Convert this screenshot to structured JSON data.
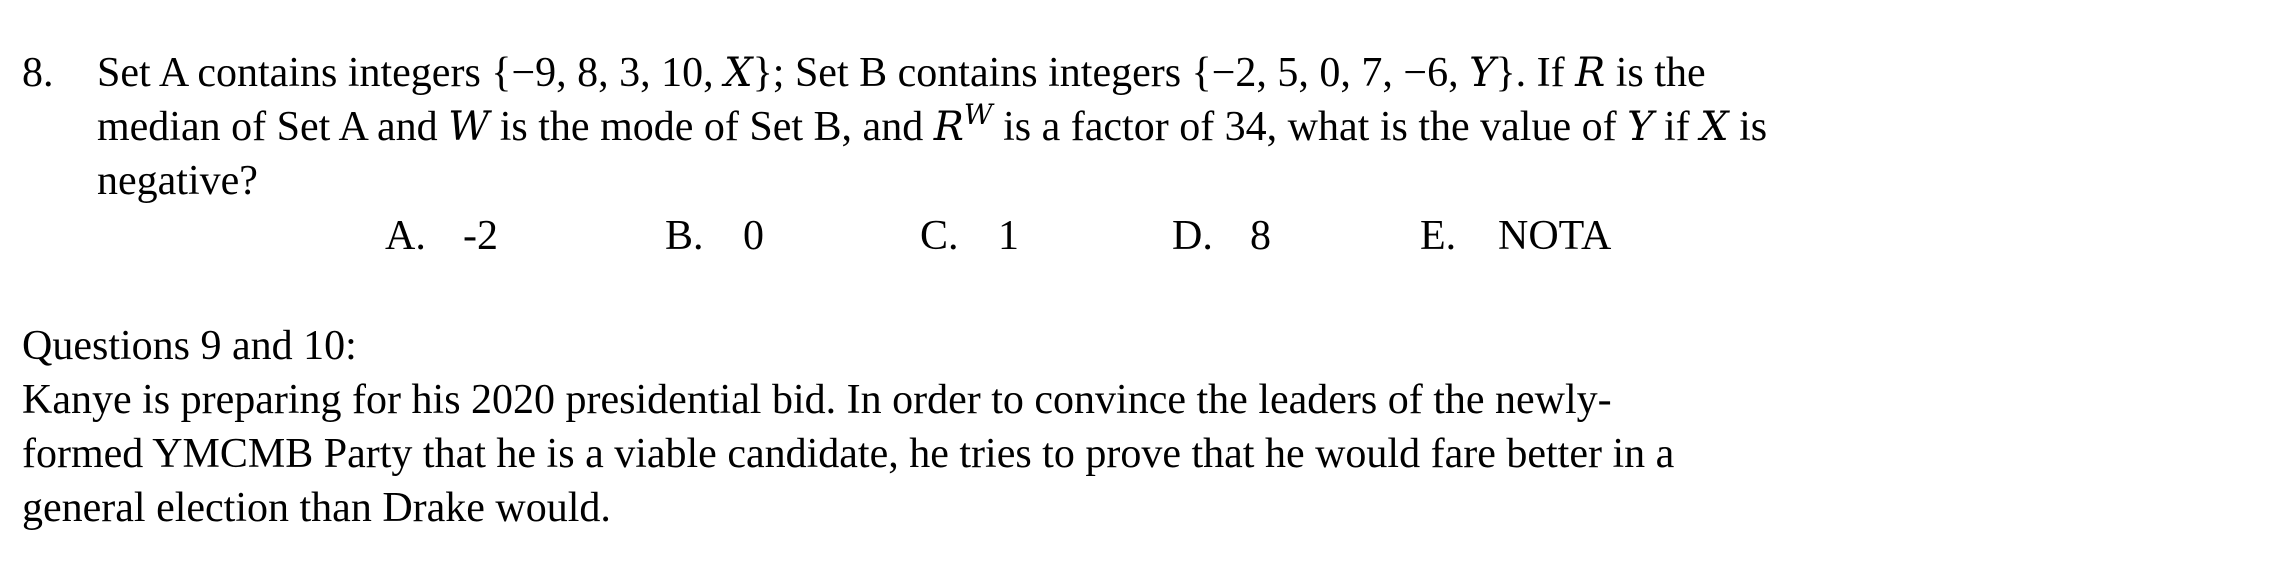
{
  "question": {
    "number": "8.",
    "line1": {
      "t1": "Set A contains integers {−9, 8, 3, 10, ",
      "x1": "X",
      "t2": "}; Set B contains integers {−2, 5, 0, 7, −6, ",
      "y1": "Y",
      "t3": "}. If ",
      "r1": "R",
      "t4": " is the"
    },
    "line2": {
      "t1": "median of Set A and ",
      "w1": "W",
      "t2": " is the mode of Set B, and ",
      "r2": "R",
      "sup": "W",
      "t3": " is a factor of 34, what is the value of ",
      "y2": "Y",
      "t4": " if ",
      "x2": "X",
      "t5": " is"
    },
    "line3": "negative?",
    "choices": [
      {
        "letter": "A.",
        "value": "-2"
      },
      {
        "letter": "B.",
        "value": "0"
      },
      {
        "letter": "C.",
        "value": "1"
      },
      {
        "letter": "D.",
        "value": "8"
      },
      {
        "letter": "E.",
        "value": "NOTA"
      }
    ]
  },
  "section": {
    "heading": "Questions 9 and 10:",
    "passage_lines": [
      "Kanye is preparing for his 2020 presidential bid. In order to convince the leaders of the newly-",
      "formed YMCMB Party that he is a viable candidate, he tries to prove that he would fare better in a",
      "general election than Drake would."
    ]
  }
}
